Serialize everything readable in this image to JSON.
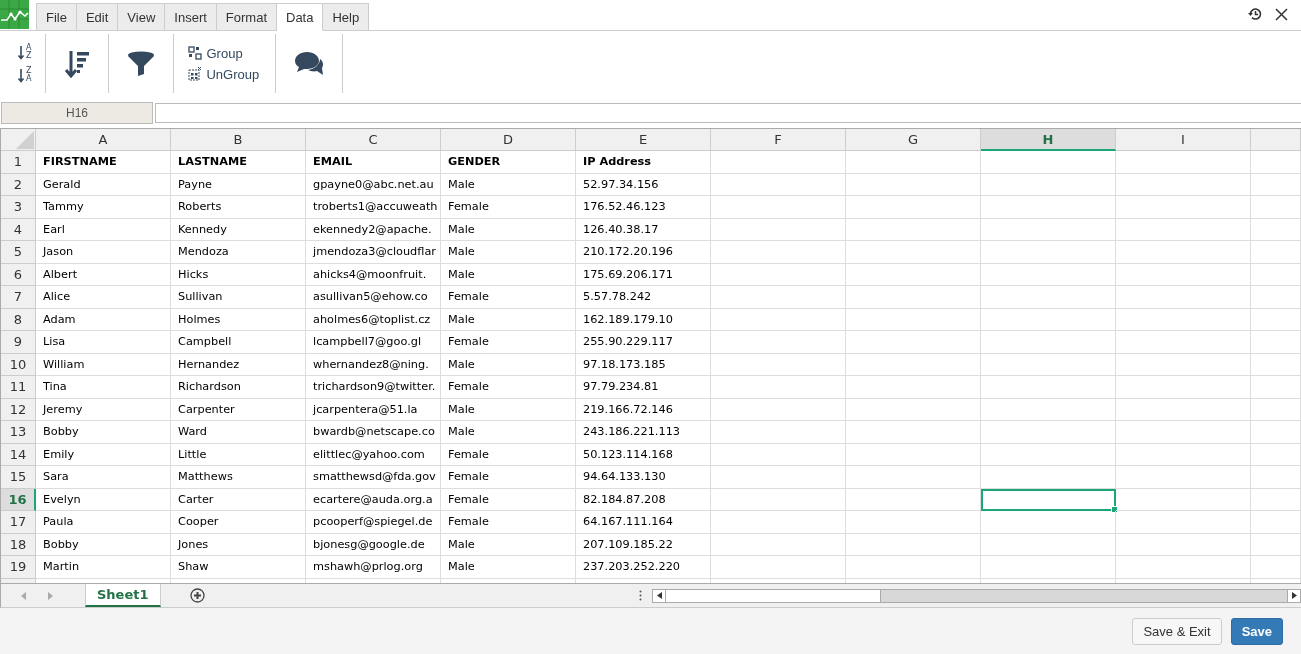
{
  "menu_tabs": [
    {
      "label": "File",
      "selected": false
    },
    {
      "label": "Edit",
      "selected": false
    },
    {
      "label": "View",
      "selected": false
    },
    {
      "label": "Insert",
      "selected": false
    },
    {
      "label": "Format",
      "selected": false
    },
    {
      "label": "Data",
      "selected": true
    },
    {
      "label": "Help",
      "selected": false
    }
  ],
  "ribbon": {
    "sort_buttons": [
      {
        "top": "A",
        "bottom": "Z"
      },
      {
        "top": "Z",
        "bottom": "A"
      }
    ],
    "group_buttons": [
      {
        "label": "Group",
        "kind": "group"
      },
      {
        "label": "UnGroup",
        "kind": "ungroup"
      }
    ]
  },
  "name_box": {
    "value": "H16"
  },
  "sheet": {
    "columns": [
      {
        "label": "A",
        "selected": false
      },
      {
        "label": "B",
        "selected": false
      },
      {
        "label": "C",
        "selected": false
      },
      {
        "label": "D",
        "selected": false
      },
      {
        "label": "E",
        "selected": false
      },
      {
        "label": "F",
        "selected": false
      },
      {
        "label": "G",
        "selected": false
      },
      {
        "label": "H",
        "selected": true
      },
      {
        "label": "I",
        "selected": false
      }
    ],
    "rows": [
      {
        "number": "1",
        "selected": false,
        "bold": true,
        "cells": [
          "FIRSTNAME",
          "LASTNAME",
          "EMAIL",
          "GENDER",
          "IP Address"
        ]
      },
      {
        "number": "2",
        "selected": false,
        "bold": false,
        "cells": [
          "Gerald",
          "Payne",
          "gpayne0@abc.net.au",
          "Male",
          "52.97.34.156"
        ]
      },
      {
        "number": "3",
        "selected": false,
        "bold": false,
        "cells": [
          "Tammy",
          "Roberts",
          "troberts1@accuweath",
          "Female",
          "176.52.46.123"
        ]
      },
      {
        "number": "4",
        "selected": false,
        "bold": false,
        "cells": [
          "Earl",
          "Kennedy",
          "ekennedy2@apache.",
          "Male",
          "126.40.38.17"
        ]
      },
      {
        "number": "5",
        "selected": false,
        "bold": false,
        "cells": [
          "Jason",
          "Mendoza",
          "jmendoza3@cloudflar",
          "Male",
          "210.172.20.196"
        ]
      },
      {
        "number": "6",
        "selected": false,
        "bold": false,
        "cells": [
          "Albert",
          "Hicks",
          "ahicks4@moonfruit.",
          "Male",
          "175.69.206.171"
        ]
      },
      {
        "number": "7",
        "selected": false,
        "bold": false,
        "cells": [
          "Alice",
          "Sullivan",
          "asullivan5@ehow.co",
          "Female",
          "5.57.78.242"
        ]
      },
      {
        "number": "8",
        "selected": false,
        "bold": false,
        "cells": [
          "Adam",
          "Holmes",
          "aholmes6@toplist.cz",
          "Male",
          "162.189.179.10"
        ]
      },
      {
        "number": "9",
        "selected": false,
        "bold": false,
        "cells": [
          "Lisa",
          "Campbell",
          "lcampbell7@goo.gl",
          "Female",
          "255.90.229.117"
        ]
      },
      {
        "number": "10",
        "selected": false,
        "bold": false,
        "cells": [
          "William",
          "Hernandez",
          "whernandez8@ning.",
          "Male",
          "97.18.173.185"
        ]
      },
      {
        "number": "11",
        "selected": false,
        "bold": false,
        "cells": [
          "Tina",
          "Richardson",
          "trichardson9@twitter.",
          "Female",
          "97.79.234.81"
        ]
      },
      {
        "number": "12",
        "selected": false,
        "bold": false,
        "cells": [
          "Jeremy",
          "Carpenter",
          "jcarpentera@51.la",
          "Male",
          "219.166.72.146"
        ]
      },
      {
        "number": "13",
        "selected": false,
        "bold": false,
        "cells": [
          "Bobby",
          "Ward",
          "bwardb@netscape.co",
          "Male",
          "243.186.221.113"
        ]
      },
      {
        "number": "14",
        "selected": false,
        "bold": false,
        "cells": [
          "Emily",
          "Little",
          "elittlec@yahoo.com",
          "Female",
          "50.123.114.168"
        ]
      },
      {
        "number": "15",
        "selected": false,
        "bold": false,
        "cells": [
          "Sara",
          "Matthews",
          "smatthewsd@fda.gov",
          "Female",
          "94.64.133.130"
        ]
      },
      {
        "number": "16",
        "selected": true,
        "bold": false,
        "cells": [
          "Evelyn",
          "Carter",
          "ecartere@auda.org.a",
          "Female",
          "82.184.87.208"
        ]
      },
      {
        "number": "17",
        "selected": false,
        "bold": false,
        "cells": [
          "Paula",
          "Cooper",
          "pcooperf@spiegel.de",
          "Female",
          "64.167.111.164"
        ]
      },
      {
        "number": "18",
        "selected": false,
        "bold": false,
        "cells": [
          "Bobby",
          "Jones",
          "bjonesg@google.de",
          "Male",
          "207.109.185.22"
        ]
      },
      {
        "number": "19",
        "selected": false,
        "bold": false,
        "cells": [
          "Martin",
          "Shaw",
          "mshawh@prlog.org",
          "Male",
          "237.203.252.220"
        ]
      }
    ]
  },
  "sheet_tabs": [
    {
      "label": "Sheet1",
      "selected": true
    }
  ],
  "buttons": [
    {
      "label": "Save & Exit",
      "kind": "secondary"
    },
    {
      "label": "Save",
      "kind": "primary"
    }
  ]
}
